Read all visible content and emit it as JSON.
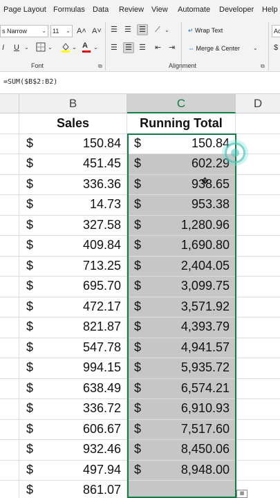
{
  "ribbon_tabs": [
    "Page Layout",
    "Formulas",
    "Data",
    "Review",
    "View",
    "Automate",
    "Developer",
    "Help"
  ],
  "ribbon": {
    "font_name": "s Narrow",
    "font_size": "11",
    "grow_font": "A˄",
    "shrink_font": "A˅",
    "italic": "I",
    "underline": "U",
    "font_color_glyph": "A",
    "font_group_label": "Font",
    "wrap_text": "Wrap Text",
    "merge_center": "Merge & Center",
    "alignment_group_label": "Alignment",
    "cut_off_label": "Ac"
  },
  "formula_bar": {
    "formula": "=SUM($B$2:B2)"
  },
  "columns": {
    "b": "B",
    "c": "C",
    "d": "D"
  },
  "headers": {
    "sales": "Sales",
    "running_total": "Running Total"
  },
  "currency_symbol": "$",
  "rows": [
    {
      "sales": "150.84",
      "total": "150.84"
    },
    {
      "sales": "451.45",
      "total": "602.29"
    },
    {
      "sales": "336.36",
      "total": "938.65"
    },
    {
      "sales": "14.73",
      "total": "953.38"
    },
    {
      "sales": "327.58",
      "total": "1,280.96"
    },
    {
      "sales": "409.84",
      "total": "1,690.80"
    },
    {
      "sales": "713.25",
      "total": "2,404.05"
    },
    {
      "sales": "695.70",
      "total": "3,099.75"
    },
    {
      "sales": "472.17",
      "total": "3,571.92"
    },
    {
      "sales": "821.87",
      "total": "4,393.79"
    },
    {
      "sales": "547.78",
      "total": "4,941.57"
    },
    {
      "sales": "994.15",
      "total": "5,935.72"
    },
    {
      "sales": "638.49",
      "total": "6,574.21"
    },
    {
      "sales": "336.72",
      "total": "6,910.93"
    },
    {
      "sales": "606.67",
      "total": "7,517.60"
    },
    {
      "sales": "932.46",
      "total": "8,450.06"
    },
    {
      "sales": "497.94",
      "total": "8,948.00"
    },
    {
      "sales": "861.07",
      "total": ""
    }
  ],
  "colors": {
    "selection_green": "#107c41",
    "selected_fill": "#c6c6c6"
  }
}
